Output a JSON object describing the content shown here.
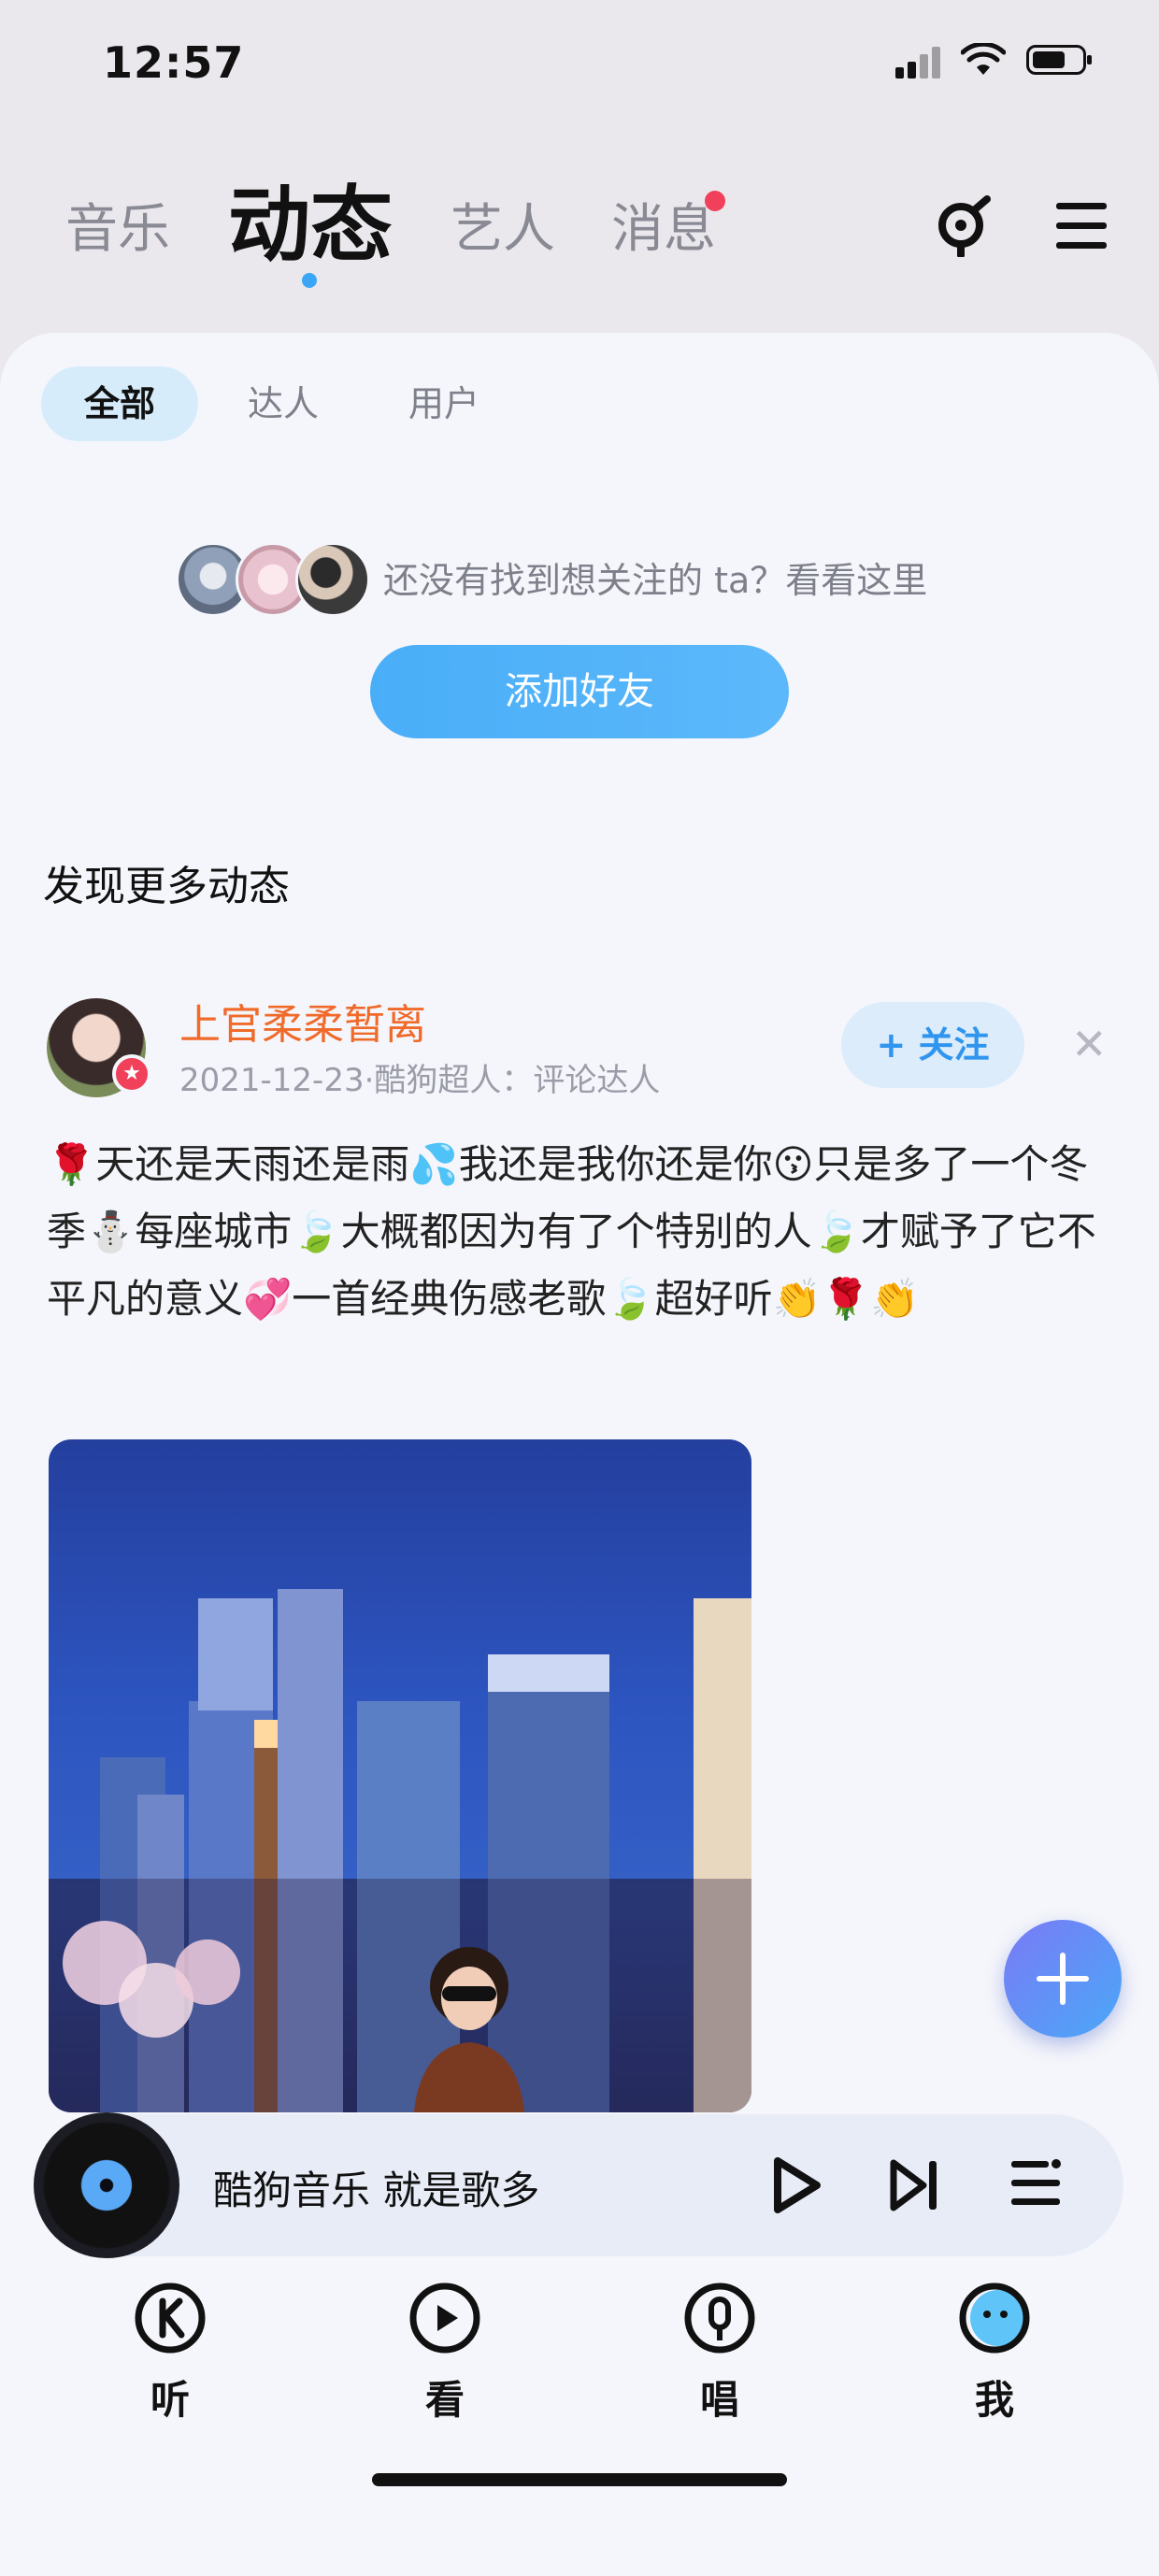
{
  "status_bar": {
    "time": "12:57"
  },
  "top_tabs": [
    {
      "label": "音乐",
      "active": false
    },
    {
      "label": "动态",
      "active": true
    },
    {
      "label": "艺人",
      "active": false
    },
    {
      "label": "消息",
      "active": false,
      "has_badge": true
    }
  ],
  "header_icons": [
    "music-recognition-icon",
    "menu-icon"
  ],
  "sub_tabs": [
    {
      "label": "全部",
      "active": true
    },
    {
      "label": "达人",
      "active": false
    },
    {
      "label": "用户",
      "active": false
    }
  ],
  "recommend": {
    "hint": "还没有找到想关注的 ta？看看这里",
    "add_friend_label": "添加好友"
  },
  "section_title": "发现更多动态",
  "post": {
    "author": "上官柔柔暂离",
    "meta": "2021-12-23·酷狗超人：评论达人",
    "follow_label": "+ 关注",
    "close_glyph": "✕",
    "text": "🌹天还是天雨还是雨💦我还是我你还是你😗只是多了一个冬季⛄每座城市🍃大概都因为有了个特别的人🍃才赋予了它不平凡的意义💞一首经典伤感老歌🍃超好听👏🌹👏"
  },
  "player": {
    "text": "酷狗音乐   就是歌多"
  },
  "bottom_nav": [
    {
      "label": "听",
      "icon": "listen-icon"
    },
    {
      "label": "看",
      "icon": "watch-icon"
    },
    {
      "label": "唱",
      "icon": "sing-icon"
    },
    {
      "label": "我",
      "icon": "me-icon"
    }
  ],
  "colors": {
    "accent": "#3aa6f5",
    "author_name": "#f06a2a",
    "badge": "#f0405a"
  }
}
